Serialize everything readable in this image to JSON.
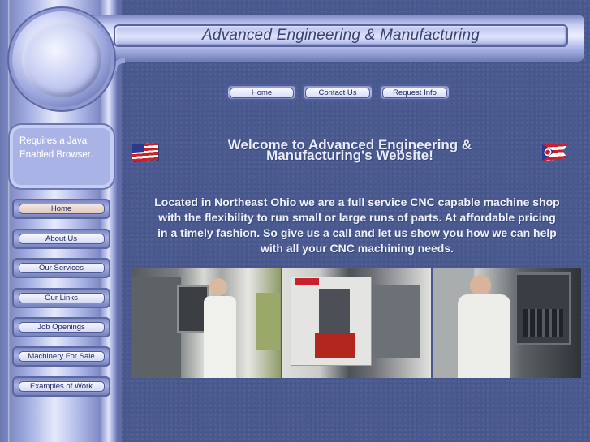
{
  "header": {
    "title": "Advanced Engineering & Manufacturing"
  },
  "java_notice": {
    "text": "Requires a Java Enabled Browser."
  },
  "top_nav": [
    {
      "label": "Home"
    },
    {
      "label": "Contact Us"
    },
    {
      "label": "Request Info"
    }
  ],
  "sidebar": {
    "items": [
      {
        "label": "Home",
        "active": true
      },
      {
        "label": "About Us"
      },
      {
        "label": "Our Services"
      },
      {
        "label": "Our Links"
      },
      {
        "label": "Job Openings"
      },
      {
        "label": "Machinery For Sale"
      },
      {
        "label": "Examples of Work"
      }
    ]
  },
  "welcome": {
    "line1": "Welcome to Advanced Engineering &",
    "line2": "Manufacturing's Website!"
  },
  "intro": {
    "text": "Located in Northeast Ohio we are a full service CNC capable machine shop with the flexibility to run small or large runs of parts. At affordable pricing in a timely fashion. So give us a call and let us show you how we can help with all your CNC machining needs."
  },
  "icons": {
    "us_flag": "us-flag-icon",
    "ohio_flag": "ohio-flag-icon"
  },
  "colors": {
    "background": "#4a5a90",
    "title_text": "#3a4370"
  }
}
